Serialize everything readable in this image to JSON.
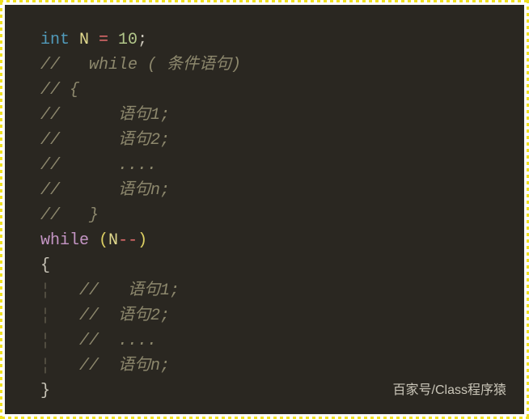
{
  "code": {
    "line1": {
      "kw": "int",
      "var": " N ",
      "op1": "=",
      "num": " 10",
      "semi": ";"
    },
    "line2": "//   while ( 条件语句)",
    "line3": "// {",
    "line4": "//      语句1;",
    "line5": "//      语句2;",
    "line6": "//      ....",
    "line7": "//      语句n;",
    "line8": "//   }",
    "line9": {
      "kw": "while",
      "space": " ",
      "paren1": "(",
      "var": "N",
      "op": "--",
      "paren2": ")"
    },
    "line10": "{",
    "line11_guide": "¦",
    "line11_comment": "   //   语句1;",
    "line12_guide": "¦",
    "line12_comment": "   //  语句2;",
    "line13_guide": "¦",
    "line13_comment": "   //  ....",
    "line14_guide": "¦",
    "line14_comment": "   //  语句n;",
    "line15": "}"
  },
  "watermark": "百家号/Class程序猿"
}
